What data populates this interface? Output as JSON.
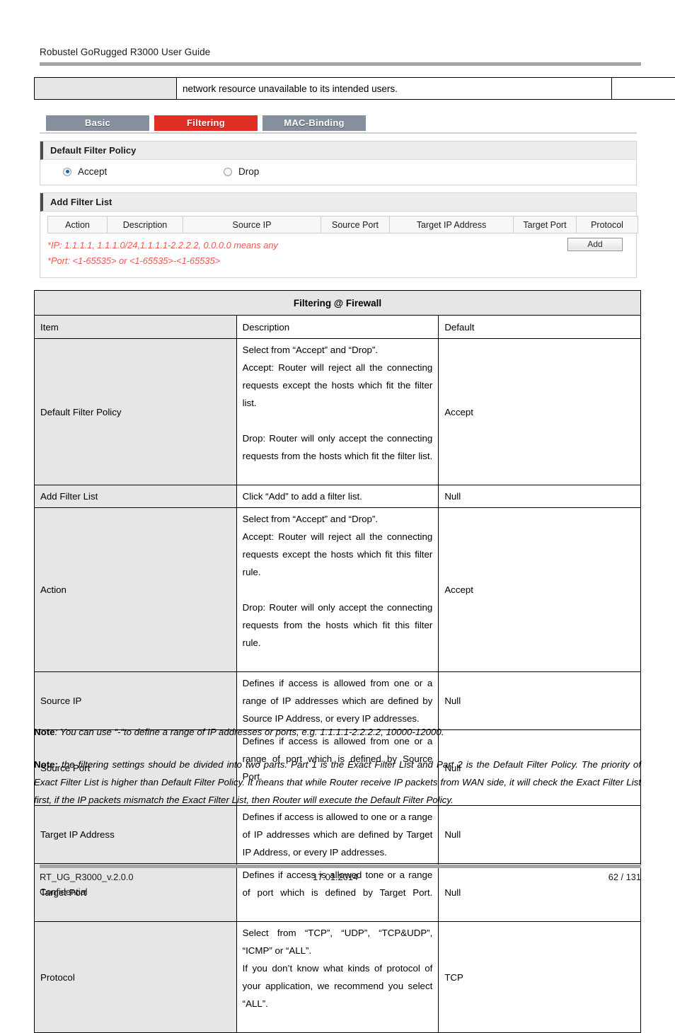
{
  "header": {
    "title": "Robustel GoRugged R3000 User Guide"
  },
  "continuation_row": {
    "item": "",
    "description": "network resource unavailable to its intended users.",
    "default": ""
  },
  "ui_screenshot": {
    "tabs": [
      {
        "label": "Basic",
        "active": false
      },
      {
        "label": "Filtering",
        "active": true
      },
      {
        "label": "MAC-Binding",
        "active": false
      }
    ],
    "default_filter_policy": {
      "section_title": "Default Filter Policy",
      "options": [
        {
          "label": "Accept",
          "selected": true
        },
        {
          "label": "Drop",
          "selected": false
        }
      ]
    },
    "add_filter_list": {
      "section_title": "Add Filter List",
      "columns": [
        "Action",
        "Description",
        "Source IP",
        "Source Port",
        "Target IP Address",
        "Target Port",
        "Protocol"
      ],
      "hints": [
        "*IP: 1.1.1.1, 1.1.1.0/24,1.1.1.1-2.2.2.2, 0.0.0.0 means any",
        "*Port: <1-65535> or <1-65535>-<1-65535>"
      ],
      "add_button": "Add"
    },
    "colors": {
      "tab_inactive": "#858f9e",
      "tab_active": "#e12f25",
      "hint_text": "#f2564e",
      "radio_selected": "#1464b4"
    }
  },
  "reference_table": {
    "title": "Filtering @ Firewall",
    "headers": {
      "item": "Item",
      "description": "Description",
      "default": "Default"
    },
    "rows": [
      {
        "item": "Default Filter Policy",
        "description_lines": [
          "Select from “Accept” and “Drop”.",
          "Accept: Router will reject all the connecting requests except the hosts which fit the filter list.",
          "Drop: Router will only accept the connecting requests from the hosts which fit the filter list."
        ],
        "default": "Accept"
      },
      {
        "item": "Add Filter List",
        "description_lines": [
          "Click “Add” to add a filter list."
        ],
        "default": "Null"
      },
      {
        "item": "Action",
        "description_lines": [
          "Select from “Accept” and “Drop”.",
          "Accept: Router will reject all the connecting requests except the hosts which fit this filter rule.",
          "Drop: Router will only accept the connecting requests from the hosts which fit this filter rule."
        ],
        "default": "Accept"
      },
      {
        "item": "Source IP",
        "description_lines": [
          "Defines if access is allowed from one or a range of IP addresses which are defined by Source IP Address, or every IP addresses."
        ],
        "default": "Null"
      },
      {
        "item": "Source Port",
        "description_lines": [
          "Defines if access is allowed from one or a range of port which is defined by Source Port."
        ],
        "default": "Null"
      },
      {
        "item": "Target IP Address",
        "description_lines": [
          "Defines if access is allowed to one or a range of IP addresses which are defined by Target IP Address, or every IP addresses."
        ],
        "default": "Null"
      },
      {
        "item": "Target Port",
        "description_lines": [
          "Defines if access is allowed tone or a range of port which is defined by Target Port."
        ],
        "default": "Null"
      },
      {
        "item": "Protocol",
        "description_lines": [
          "Select from “TCP”, “UDP”, “TCP&UDP”, “ICMP” or “ALL”.",
          "If you don’t know what kinds of protocol of your application, we recommend you select “ALL”."
        ],
        "default": "TCP"
      }
    ]
  },
  "notes": {
    "note1_label": "Note",
    "note1_text": ": You can use “-“to define a range of IP addresses or ports, e.g. 1.1.1.1-2.2.2.2, 10000-12000.",
    "note2_label": "Note:",
    "note2_text": " the filtering settings should be divided into two parts. Part 1 is the Exact Filter List and Part 2 is the Default Filter Policy. The priority of Exact Filter List is higher than Default Filter Policy. It means that while Router receive IP packets from WAN side, it will check the Exact Filter List first, if the IP packets mismatch the Exact Filter List, then Router will execute the Default Filter Policy."
  },
  "footer": {
    "document_id": "RT_UG_R3000_v.2.0.0",
    "date": "17.01.2014",
    "page": "62 / 131",
    "classification": "Confidential"
  }
}
